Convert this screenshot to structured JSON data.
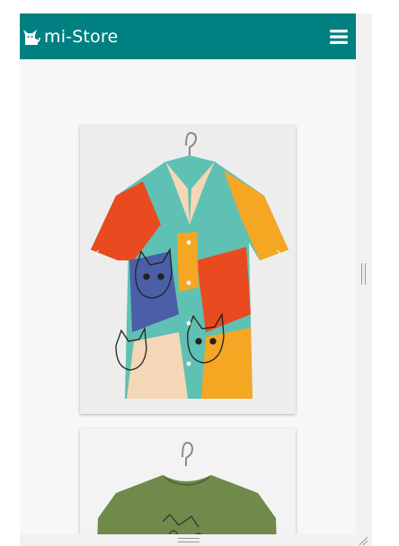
{
  "app": {
    "brand_name": "mi-Store"
  },
  "navbar": {
    "brand_icon": "cat-icon",
    "menu_icon": "hamburger-menu-icon",
    "background_color": "#008080",
    "text_color": "#ffffff"
  },
  "products": [
    {
      "image_icon": "patterned-cat-print-shirt",
      "colors": [
        "#e94a1f",
        "#5fc1b3",
        "#f5a623",
        "#4b5fa8"
      ]
    },
    {
      "image_icon": "olive-graphic-tshirt",
      "colors": [
        "#6f8a4a"
      ]
    }
  ],
  "carousel": {
    "prev_icon": "chevron-left-icon",
    "next_icon": "chevron-right-icon"
  },
  "frame": {
    "splitter_icon": "vertical-resize-handle-icon",
    "bottom_handle_icon": "horizontal-resize-handle-icon",
    "grip_icon": "resize-grip-icon"
  }
}
